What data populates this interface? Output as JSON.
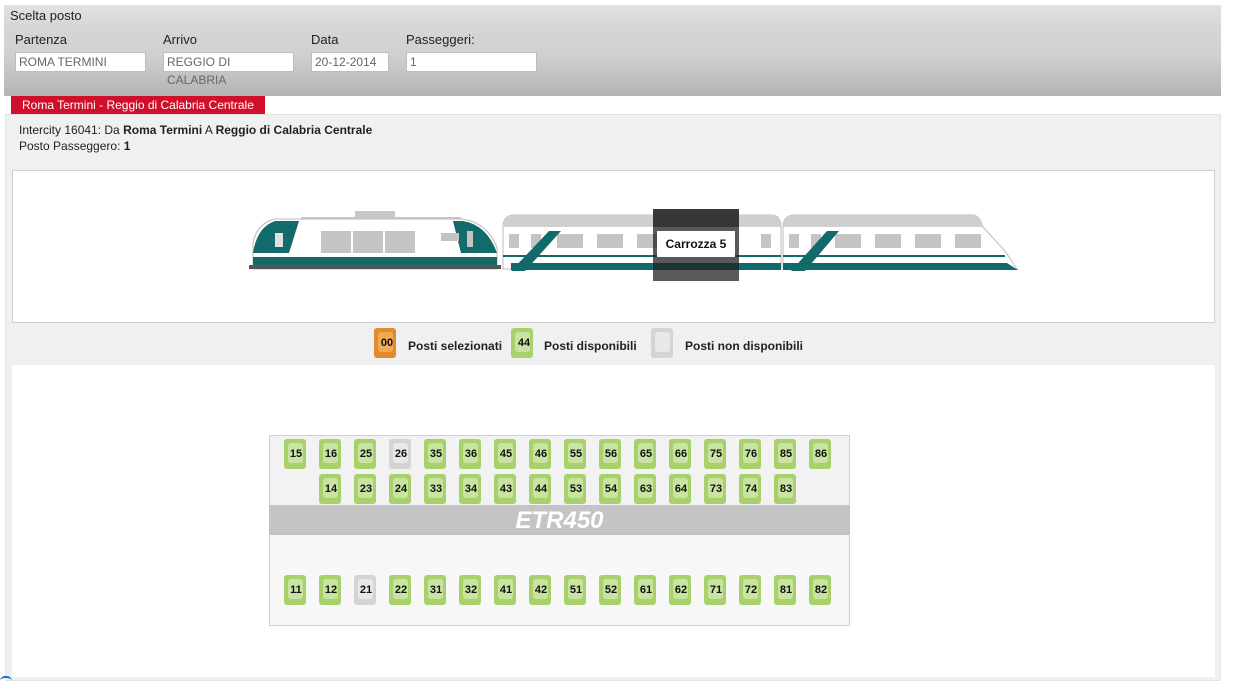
{
  "panel_title": "Scelta posto",
  "form": {
    "fields": [
      {
        "label": "Partenza",
        "value": "ROMA TERMINI"
      },
      {
        "label": "Arrivo",
        "value": "REGGIO DI CALABRIA"
      },
      {
        "label": "Data",
        "value": "20-12-2014"
      },
      {
        "label": "Passeggeri:",
        "value": "1"
      }
    ]
  },
  "route_tab": "Roma Termini - Reggio di Calabria Centrale",
  "info": {
    "train_prefix": "Intercity 16041: Da",
    "from": "Roma Termini",
    "to_prefix": "A",
    "to": "Reggio di Calabria Centrale",
    "seat_label": "Posto Passeggero:",
    "seat_value": "1"
  },
  "train": {
    "selected_car_label": "Carrozza 5",
    "colors": {
      "teal": "#136a6a",
      "body": "#ffffff",
      "roof": "#c8c8c8",
      "window": "#c0c0c0",
      "highlight": "#555555"
    }
  },
  "legend": [
    {
      "state": "selected",
      "number": "00",
      "label": "Posti selezionati"
    },
    {
      "state": "available",
      "number": "44",
      "label": "Posti disponibili"
    },
    {
      "state": "unavailable",
      "number": "",
      "label": "Posti non disponibili"
    }
  ],
  "car_model": "ETR450",
  "seat_colors": {
    "available": "#a8d16b",
    "unavailable": "#d4d4d4",
    "selected": "#e38a2c"
  },
  "seat_rows": {
    "top": [
      {
        "n": "15",
        "state": "available"
      },
      {
        "n": "16",
        "state": "available"
      },
      {
        "n": "25",
        "state": "available"
      },
      {
        "n": "26",
        "state": "unavailable"
      },
      {
        "n": "35",
        "state": "available"
      },
      {
        "n": "36",
        "state": "available"
      },
      {
        "n": "45",
        "state": "available"
      },
      {
        "n": "46",
        "state": "available"
      },
      {
        "n": "55",
        "state": "available"
      },
      {
        "n": "56",
        "state": "available"
      },
      {
        "n": "65",
        "state": "available"
      },
      {
        "n": "66",
        "state": "available"
      },
      {
        "n": "75",
        "state": "available"
      },
      {
        "n": "76",
        "state": "available"
      },
      {
        "n": "85",
        "state": "available"
      },
      {
        "n": "86",
        "state": "available"
      }
    ],
    "second": [
      {
        "n": "14",
        "state": "available"
      },
      {
        "n": "23",
        "state": "available"
      },
      {
        "n": "24",
        "state": "available"
      },
      {
        "n": "33",
        "state": "available"
      },
      {
        "n": "34",
        "state": "available"
      },
      {
        "n": "43",
        "state": "available"
      },
      {
        "n": "44",
        "state": "available"
      },
      {
        "n": "53",
        "state": "available"
      },
      {
        "n": "54",
        "state": "available"
      },
      {
        "n": "63",
        "state": "available"
      },
      {
        "n": "64",
        "state": "available"
      },
      {
        "n": "73",
        "state": "available"
      },
      {
        "n": "74",
        "state": "available"
      },
      {
        "n": "83",
        "state": "available"
      }
    ],
    "bottom": [
      {
        "n": "11",
        "state": "available"
      },
      {
        "n": "12",
        "state": "available"
      },
      {
        "n": "21",
        "state": "unavailable"
      },
      {
        "n": "22",
        "state": "available"
      },
      {
        "n": "31",
        "state": "available"
      },
      {
        "n": "32",
        "state": "available"
      },
      {
        "n": "41",
        "state": "available"
      },
      {
        "n": "42",
        "state": "available"
      },
      {
        "n": "51",
        "state": "available"
      },
      {
        "n": "52",
        "state": "available"
      },
      {
        "n": "61",
        "state": "available"
      },
      {
        "n": "62",
        "state": "available"
      },
      {
        "n": "71",
        "state": "available"
      },
      {
        "n": "72",
        "state": "available"
      },
      {
        "n": "81",
        "state": "available"
      },
      {
        "n": "82",
        "state": "available"
      }
    ]
  }
}
